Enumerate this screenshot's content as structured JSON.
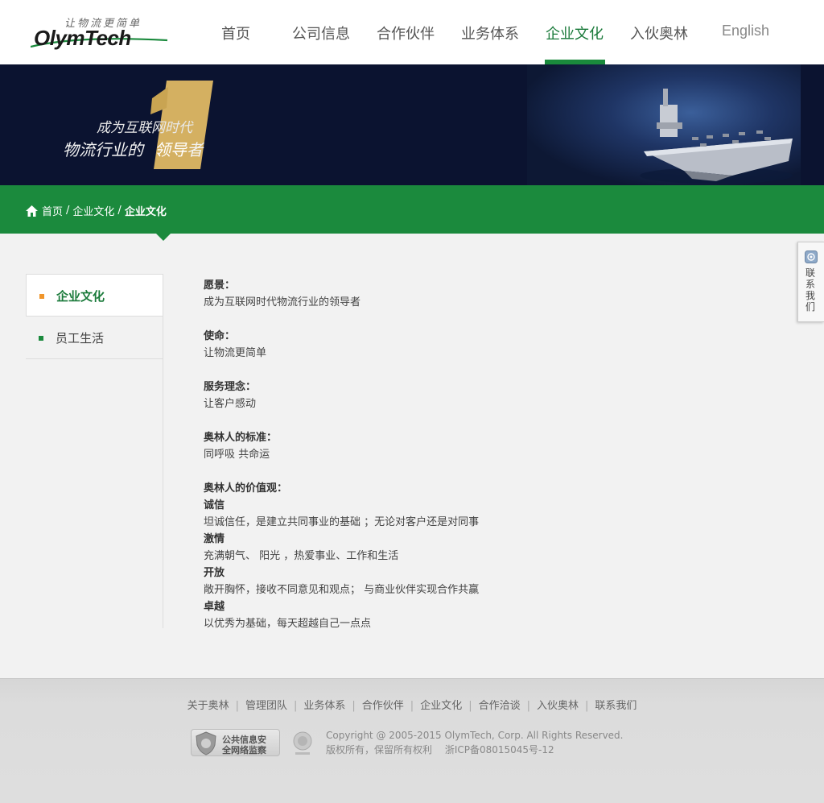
{
  "logo": {
    "slogan": "让物流更简单",
    "brand_pre": "Olym",
    "brand_t": "T",
    "brand_post": "ech"
  },
  "nav": {
    "items": [
      {
        "label": "首页"
      },
      {
        "label": "公司信息"
      },
      {
        "label": "合作伙伴"
      },
      {
        "label": "业务体系"
      },
      {
        "label": "企业文化"
      },
      {
        "label": "入伙奥林"
      },
      {
        "label": "English"
      }
    ],
    "active": "企业文化"
  },
  "banner": {
    "line1": "成为互联网时代",
    "line2_a": "物流行业的",
    "line2_b": "领导",
    "line2_c": "者"
  },
  "breadcrumb": {
    "home": "首页",
    "section": "企业文化",
    "current": "企业文化"
  },
  "sidebar": {
    "items": [
      {
        "label": "企业文化",
        "active": true
      },
      {
        "label": "员工生活",
        "active": false
      }
    ]
  },
  "content": {
    "vision_title": "愿景：",
    "vision_text": "成为互联网时代物流行业的领导者",
    "mission_title": "使命：",
    "mission_text": "让物流更简单",
    "service_title": "服务理念：",
    "service_text": "让客户感动",
    "standard_title": "奥林人的标准：",
    "standard_text": "同呼吸 共命运",
    "values_title": "奥林人的价值观：",
    "v1_title": "诚信",
    "v1_text": "坦诚信任，是建立共同事业的基础 ；无论对客户还是对同事",
    "v2_title": "激情",
    "v2_text": "充满朝气、 阳光 ，热爱事业、工作和生活",
    "v3_title": "开放",
    "v3_text": "敞开胸怀，接收不同意见和观点； 与商业伙伴实现合作共赢",
    "v4_title": "卓越",
    "v4_text": "以优秀为基础，每天超越自己一点点"
  },
  "contact": {
    "label": "联系我们"
  },
  "footer": {
    "links": [
      "关于奥林",
      "管理团队",
      "业务体系",
      "合作伙伴",
      "企业文化",
      "合作洽谈",
      "入伙奥林",
      "联系我们"
    ],
    "badge_line1": "公共信息安",
    "badge_line2": "全网络监察",
    "copyright": "Copyright @ 2005-2015 OlymTech, Corp. All Rights Reserved.",
    "icp": "版权所有，保留所有权利　 浙ICP备08015045号-12"
  },
  "colors": {
    "brand_green": "#1b8a3d",
    "banner_navy": "#0b1330",
    "gold": "#d4b061",
    "bullet_orange": "#f0952a"
  }
}
